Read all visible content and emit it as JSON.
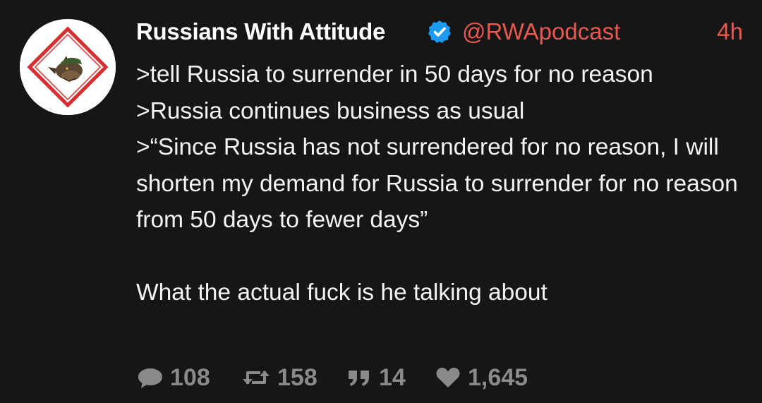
{
  "post": {
    "author": {
      "display_name": "Russians With Attitude",
      "handle": "@RWApodcast",
      "verified": true
    },
    "timestamp": "4h",
    "lines": [
      ">tell Russia to surrender in 50 days for no reason",
      ">Russia continues business as usual",
      ">“Since Russia has not surrendered for no reason, I will shorten my demand for Russia to surrender for no reason from 50 days to fewer days”",
      "What the actual fuck is he talking about"
    ],
    "stats": {
      "replies": "108",
      "reposts": "158",
      "quotes": "14",
      "likes": "1,645"
    }
  },
  "icons": {
    "reply": "speech-bubble-icon",
    "repost": "repost-arrows-icon",
    "quote": "quote-marks-icon",
    "like": "heart-icon",
    "verified": "verified-check-icon",
    "avatar": "wolf-in-diamond-avatar"
  },
  "colors": {
    "background": "#161616",
    "text": "#f3f3f3",
    "accent": "#e9584f",
    "muted": "#8a8a8a",
    "verified": "#1d9bf0"
  }
}
